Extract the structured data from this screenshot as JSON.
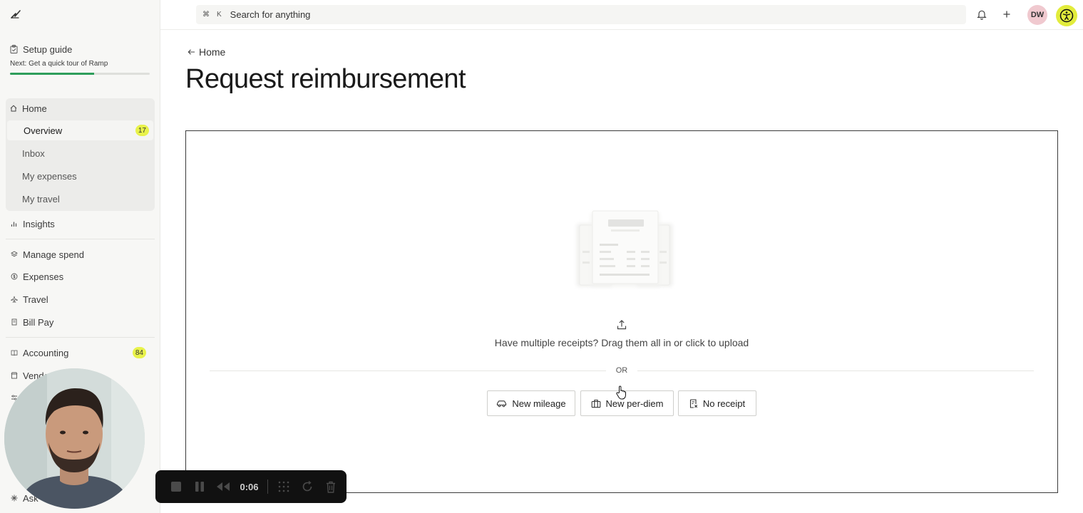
{
  "sidebar": {
    "setup": {
      "title": "Setup guide",
      "subtitle": "Next: Get a quick tour of Ramp",
      "progress": 0.6
    },
    "home": {
      "label": "Home",
      "items": [
        {
          "label": "Overview",
          "badge": "17"
        },
        {
          "label": "Inbox"
        },
        {
          "label": "My expenses"
        },
        {
          "label": "My travel"
        }
      ]
    },
    "insights": "Insights",
    "nav": [
      {
        "label": "Manage spend",
        "icon": "layers-icon"
      },
      {
        "label": "Expenses",
        "icon": "dollar-icon"
      },
      {
        "label": "Travel",
        "icon": "plane-icon"
      },
      {
        "label": "Bill Pay",
        "icon": "document-icon"
      }
    ],
    "accounting": {
      "label": "Accounting",
      "badge": "84"
    },
    "vendors": "Vendo",
    "ask": "Ask"
  },
  "topbar": {
    "search_kbd_cmd": "⌘",
    "search_kbd_key": "K",
    "search_placeholder": "Search for anything",
    "avatar_initials": "DW"
  },
  "main": {
    "back_label": "Home",
    "title": "Request reimbursement",
    "drop_text": "Have multiple receipts? Drag them all in or click to upload",
    "or_label": "OR",
    "buttons": [
      {
        "label": "New mileage",
        "icon": "car-icon"
      },
      {
        "label": "New per-diem",
        "icon": "briefcase-icon"
      },
      {
        "label": "No receipt",
        "icon": "receipt-icon"
      }
    ]
  },
  "recorder": {
    "time": "0:06"
  },
  "colors": {
    "accent_yellow": "#e8f24b",
    "progress_green": "#2e9e5b",
    "avatar_pink": "#f0c9cf"
  }
}
